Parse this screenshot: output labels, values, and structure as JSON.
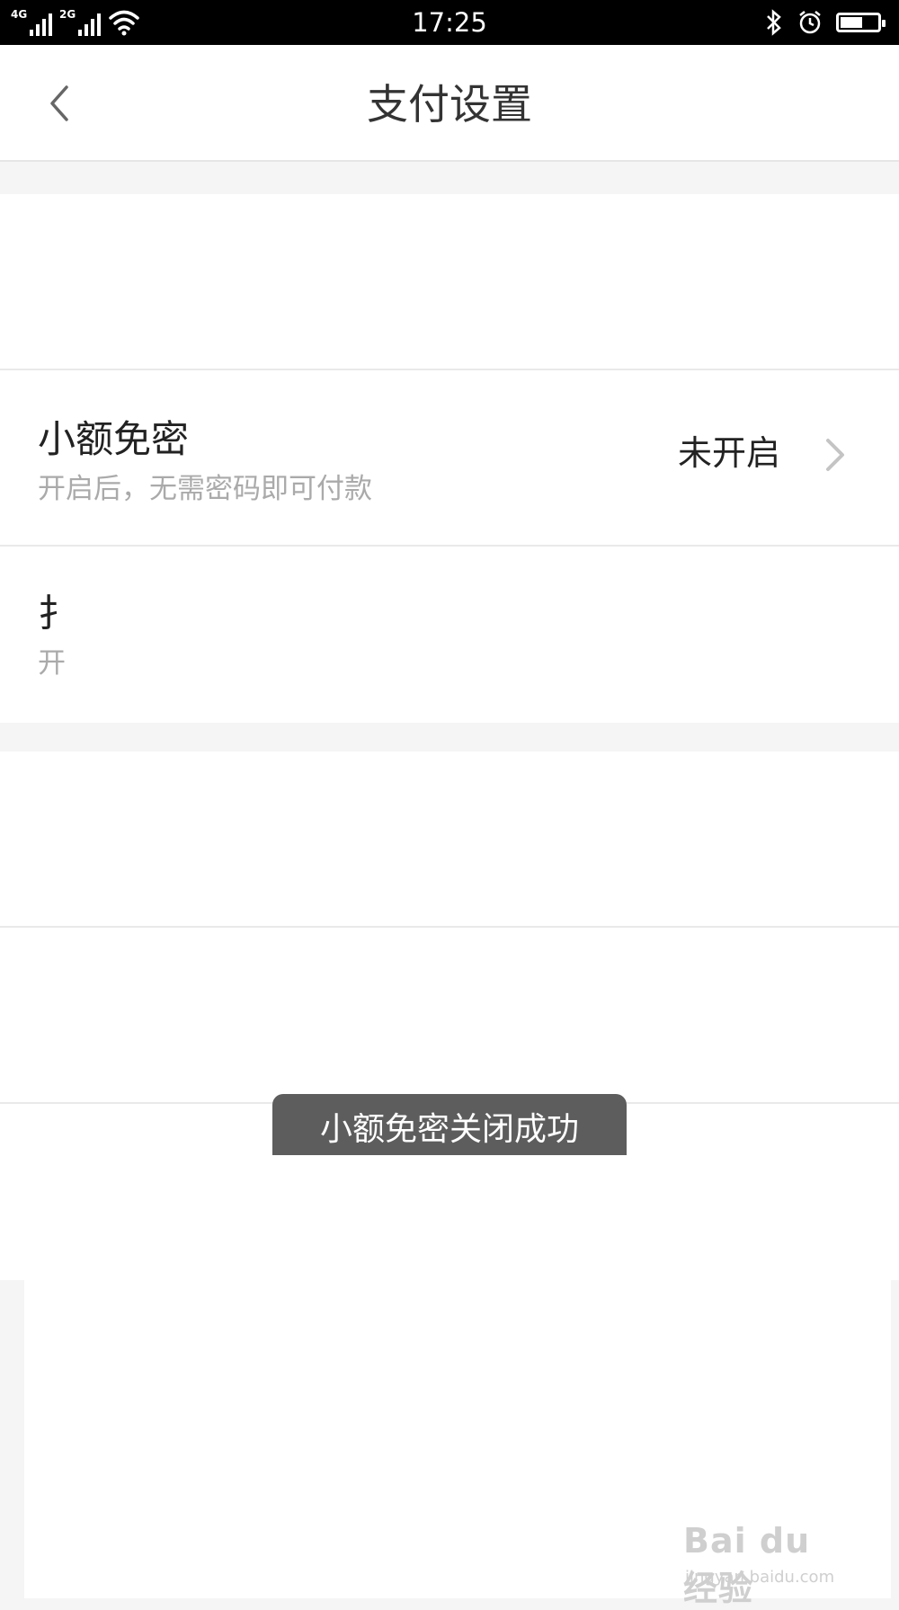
{
  "status_bar": {
    "time": "17:25",
    "network_1": "4G",
    "network_2": "2G",
    "battery_level": 0.6,
    "icons": [
      "signal-icon",
      "wifi-icon",
      "bluetooth-icon",
      "alarm-icon",
      "battery-icon"
    ]
  },
  "header": {
    "title": "支付设置",
    "back_icon": "chevron-left-icon"
  },
  "rows": {
    "small_pay": {
      "title": "小额免密",
      "subtitle": "开启后，无需密码即可付款",
      "status": "未开启"
    },
    "second": {
      "title": "扌",
      "subtitle": "开"
    }
  },
  "toast": {
    "message": "小额免密关闭成功"
  },
  "watermark": {
    "logo": "Bai du 经验",
    "url": "jingyan.baidu.com"
  },
  "colors": {
    "background": "#f5f5f5",
    "toast_background": "#5d5d5d",
    "secondary_text": "#aaaaaa"
  }
}
